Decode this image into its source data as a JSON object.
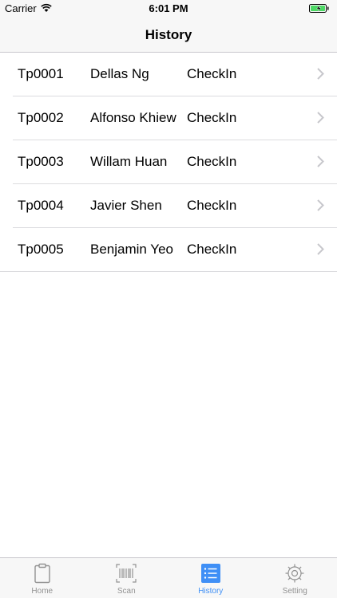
{
  "status_bar": {
    "carrier": "Carrier",
    "time": "6:01 PM",
    "battery_color": "#4cd964"
  },
  "nav": {
    "title": "History"
  },
  "history": [
    {
      "id": "Tp0001",
      "name": "Dellas Ng",
      "status": "CheckIn"
    },
    {
      "id": "Tp0002",
      "name": "Alfonso Khiew",
      "status": "CheckIn"
    },
    {
      "id": "Tp0003",
      "name": "Willam Huan",
      "status": "CheckIn"
    },
    {
      "id": "Tp0004",
      "name": "Javier Shen",
      "status": "CheckIn"
    },
    {
      "id": "Tp0005",
      "name": "Benjamin Yeo",
      "status": "CheckIn"
    }
  ],
  "tab_bar": {
    "tabs": [
      {
        "label": "Home",
        "icon": "clipboard-icon",
        "active": false
      },
      {
        "label": "Scan",
        "icon": "barcode-icon",
        "active": false
      },
      {
        "label": "History",
        "icon": "list-icon",
        "active": true
      },
      {
        "label": "Setting",
        "icon": "gear-icon",
        "active": false
      }
    ],
    "active_color": "#3f8ff6",
    "inactive_color": "#929292"
  }
}
